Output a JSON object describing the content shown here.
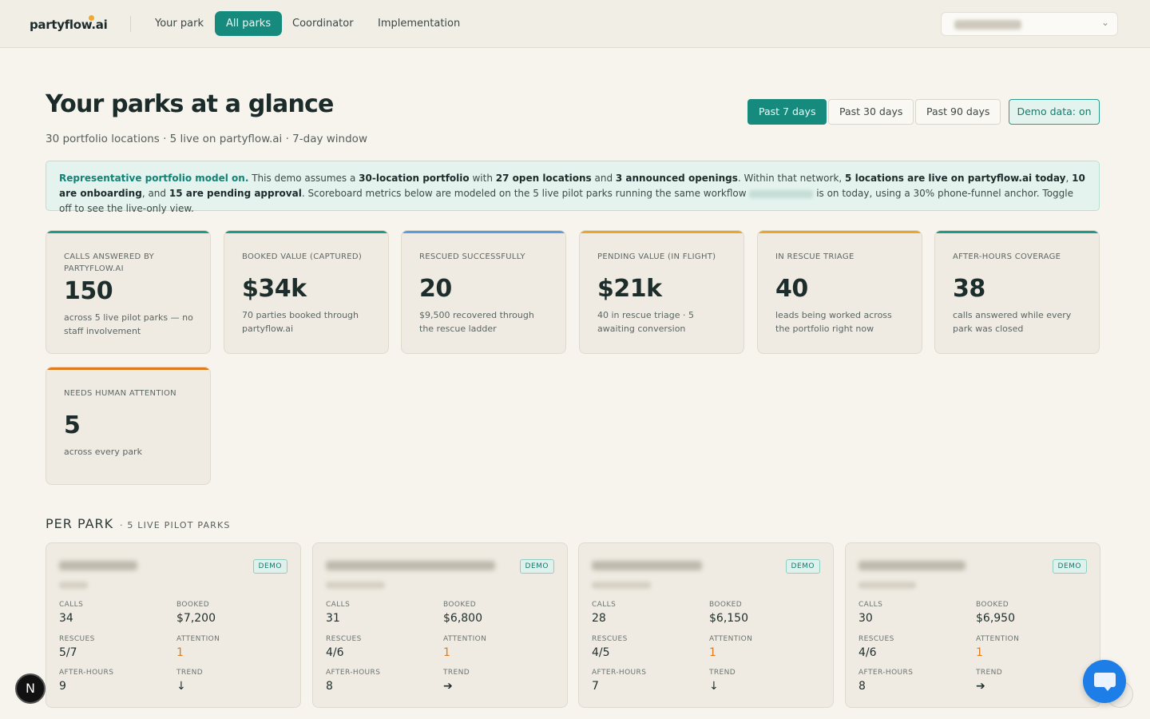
{
  "nav": {
    "logo": "partyflow.ai",
    "items": [
      "Your park",
      "All parks",
      "Coordinator",
      "Implementation"
    ],
    "active": "All parks"
  },
  "header": {
    "title": "Your parks at a glance",
    "subtitle": "30 portfolio locations · 5 live on partyflow.ai · 7-day window",
    "ranges": [
      "Past 7 days",
      "Past 30 days",
      "Past 90 days"
    ],
    "active_range": "Past 7 days",
    "demo_toggle": "Demo data: on"
  },
  "banner": {
    "lead": "Representative portfolio model on.",
    "t1": " This demo assumes a ",
    "b1": "30-location portfolio",
    "t2": " with ",
    "b2": "27 open locations",
    "t3": " and ",
    "b3": "3 announced openings",
    "t4": ". Within that network, ",
    "b4": "5 locations are live on partyflow.ai today",
    "t5": ", ",
    "b5": "10 are onboarding",
    "t6": ", and ",
    "b6": "15 are pending approval",
    "t7": ". Scoreboard metrics below are modeled on the 5 live pilot parks running the same workflow ",
    "t8": " is on today, using a 30% phone-funnel anchor. Toggle off to see the live-only view."
  },
  "stats": [
    {
      "label": "CALLS ANSWERED BY PARTYFLOW.AI",
      "value": "150",
      "desc": "across 5 live pilot parks — no staff involvement",
      "color": "#1f9a8a"
    },
    {
      "label": "BOOKED VALUE (CAPTURED)",
      "value": "$34k",
      "desc": "70 parties booked through partyflow.ai",
      "color": "#1f9a8a"
    },
    {
      "label": "RESCUED SUCCESSFULLY",
      "value": "20",
      "desc": "$9,500 recovered through the rescue ladder",
      "color": "#5b9be0"
    },
    {
      "label": "PENDING VALUE (IN FLIGHT)",
      "value": "$21k",
      "desc": "40 in rescue triage · 5 awaiting conversion",
      "color": "#e6a72a"
    },
    {
      "label": "IN RESCUE TRIAGE",
      "value": "40",
      "desc": "leads being worked across the portfolio right now",
      "color": "#e6a72a"
    },
    {
      "label": "AFTER-HOURS COVERAGE",
      "value": "38",
      "desc": "calls answered while every park was closed",
      "color": "#1f9a8a"
    },
    {
      "label": "NEEDS HUMAN ATTENTION",
      "value": "5",
      "desc": "across every park",
      "color": "#e07b1d"
    }
  ],
  "per_park": {
    "title": "PER PARK",
    "subtitle": "· 5 LIVE PILOT PARKS",
    "labels": {
      "calls": "CALLS",
      "booked": "BOOKED",
      "rescues": "RESCUES",
      "attention": "ATTENTION",
      "after_hours": "AFTER-HOURS",
      "trend": "TREND"
    },
    "badge": "DEMO",
    "parks": [
      {
        "calls": "34",
        "booked": "$7,200",
        "rescues": "5/7",
        "attention": "1",
        "after_hours": "9",
        "trend": "↓"
      },
      {
        "calls": "31",
        "booked": "$6,800",
        "rescues": "4/6",
        "attention": "1",
        "after_hours": "8",
        "trend": "➔"
      },
      {
        "calls": "28",
        "booked": "$6,150",
        "rescues": "4/5",
        "attention": "1",
        "after_hours": "7",
        "trend": "↓"
      },
      {
        "calls": "30",
        "booked": "$6,950",
        "rescues": "4/6",
        "attention": "1",
        "after_hours": "8",
        "trend": "➔"
      }
    ]
  },
  "floating": {
    "n_badge": "N",
    "chat_icon": "chat-icon"
  },
  "colors": {
    "accent": "#168a7c",
    "warning": "#e07b1d",
    "background": "#f7f4ee"
  }
}
